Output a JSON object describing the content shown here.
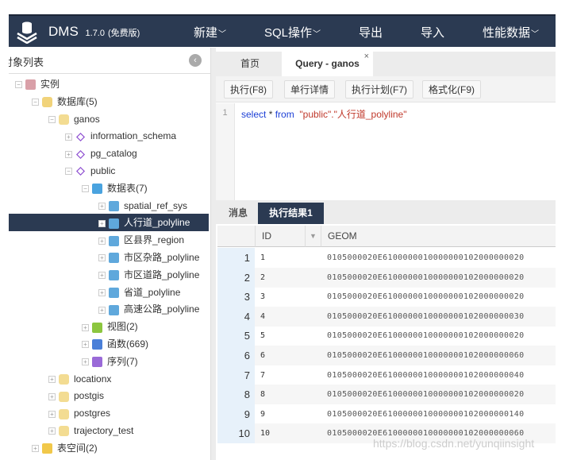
{
  "header": {
    "app_name": "DMS",
    "version": "1.7.0",
    "edition": "(免费版)",
    "menu": [
      {
        "label": "新建",
        "dropdown": true
      },
      {
        "label": "SQL操作",
        "dropdown": true
      },
      {
        "label": "导出",
        "dropdown": false
      },
      {
        "label": "导入",
        "dropdown": false
      },
      {
        "label": "性能数据",
        "dropdown": true
      }
    ]
  },
  "sidebar": {
    "title": "对象列表",
    "tree": [
      {
        "label": "实例",
        "icon": "instance-icon",
        "level": 0,
        "expanded": true
      },
      {
        "label": "数据库(5)",
        "icon": "database-group-icon",
        "level": 1,
        "expanded": true
      },
      {
        "label": "ganos",
        "icon": "database-icon",
        "level": 2,
        "expanded": true
      },
      {
        "label": "information_schema",
        "icon": "schema-icon",
        "level": 3,
        "expanded": false
      },
      {
        "label": "pg_catalog",
        "icon": "schema-icon",
        "level": 3,
        "expanded": false
      },
      {
        "label": "public",
        "icon": "schema-icon",
        "level": 3,
        "expanded": true
      },
      {
        "label": "数据表(7)",
        "icon": "tables-icon",
        "level": 4,
        "expanded": true
      },
      {
        "label": "spatial_ref_sys",
        "icon": "table-icon",
        "level": 5,
        "expanded": false
      },
      {
        "label": "人行道_polyline",
        "icon": "table-icon",
        "level": 5,
        "expanded": false,
        "selected": true
      },
      {
        "label": "区县界_region",
        "icon": "table-icon",
        "level": 5,
        "expanded": false
      },
      {
        "label": "市区杂路_polyline",
        "icon": "table-icon",
        "level": 5,
        "expanded": false
      },
      {
        "label": "市区道路_polyline",
        "icon": "table-icon",
        "level": 5,
        "expanded": false
      },
      {
        "label": "省道_polyline",
        "icon": "table-icon",
        "level": 5,
        "expanded": false
      },
      {
        "label": "高速公路_polyline",
        "icon": "table-icon",
        "level": 5,
        "expanded": false
      },
      {
        "label": "视图(2)",
        "icon": "views-icon",
        "level": 4,
        "expanded": false
      },
      {
        "label": "函数(669)",
        "icon": "functions-icon",
        "level": 4,
        "expanded": false
      },
      {
        "label": "序列(7)",
        "icon": "sequences-icon",
        "level": 4,
        "expanded": false
      },
      {
        "label": "locationx",
        "icon": "database-icon",
        "level": 2,
        "expanded": false
      },
      {
        "label": "postgis",
        "icon": "database-icon",
        "level": 2,
        "expanded": false
      },
      {
        "label": "postgres",
        "icon": "database-icon",
        "level": 2,
        "expanded": false
      },
      {
        "label": "trajectory_test",
        "icon": "database-icon",
        "level": 2,
        "expanded": false
      },
      {
        "label": "表空间(2)",
        "icon": "tablespace-icon",
        "level": 1,
        "expanded": false
      }
    ]
  },
  "tabs": [
    {
      "label": "首页",
      "active": false
    },
    {
      "label": "Query - ganos",
      "active": true,
      "closable": true
    }
  ],
  "toolbar": {
    "execute": "执行(F8)",
    "row_detail": "单行详情",
    "explain": "执行计划(F7)",
    "format": "格式化(F9)"
  },
  "editor": {
    "line_number": "1",
    "kw1": "select",
    "star": "*",
    "kw2": "from",
    "target": "\"public\".\"人行道_polyline\""
  },
  "result_tabs": [
    {
      "label": "消息",
      "active": false
    },
    {
      "label": "执行结果1",
      "active": true
    }
  ],
  "grid": {
    "columns": [
      "ID",
      "GEOM"
    ],
    "rows": [
      {
        "n": "1",
        "id": "1",
        "geom": "0105000020E6100000010000000102000000020"
      },
      {
        "n": "2",
        "id": "2",
        "geom": "0105000020E6100000010000000102000000020"
      },
      {
        "n": "3",
        "id": "3",
        "geom": "0105000020E6100000010000000102000000020"
      },
      {
        "n": "4",
        "id": "4",
        "geom": "0105000020E6100000010000000102000000030"
      },
      {
        "n": "5",
        "id": "5",
        "geom": "0105000020E6100000010000000102000000020"
      },
      {
        "n": "6",
        "id": "6",
        "geom": "0105000020E6100000010000000102000000060"
      },
      {
        "n": "7",
        "id": "7",
        "geom": "0105000020E6100000010000000102000000040"
      },
      {
        "n": "8",
        "id": "8",
        "geom": "0105000020E6100000010000000102000000020"
      },
      {
        "n": "9",
        "id": "9",
        "geom": "0105000020E6100000010000000102000000140"
      },
      {
        "n": "10",
        "id": "10",
        "geom": "0105000020E6100000010000000102000000060"
      }
    ]
  },
  "watermark": "https://blog.csdn.net/yunqiinsight",
  "colors": {
    "header_bg": "#2b3a52",
    "selected_bg": "#2b3a52",
    "keyword": "#1c3fd6",
    "string": "#c0392b"
  }
}
